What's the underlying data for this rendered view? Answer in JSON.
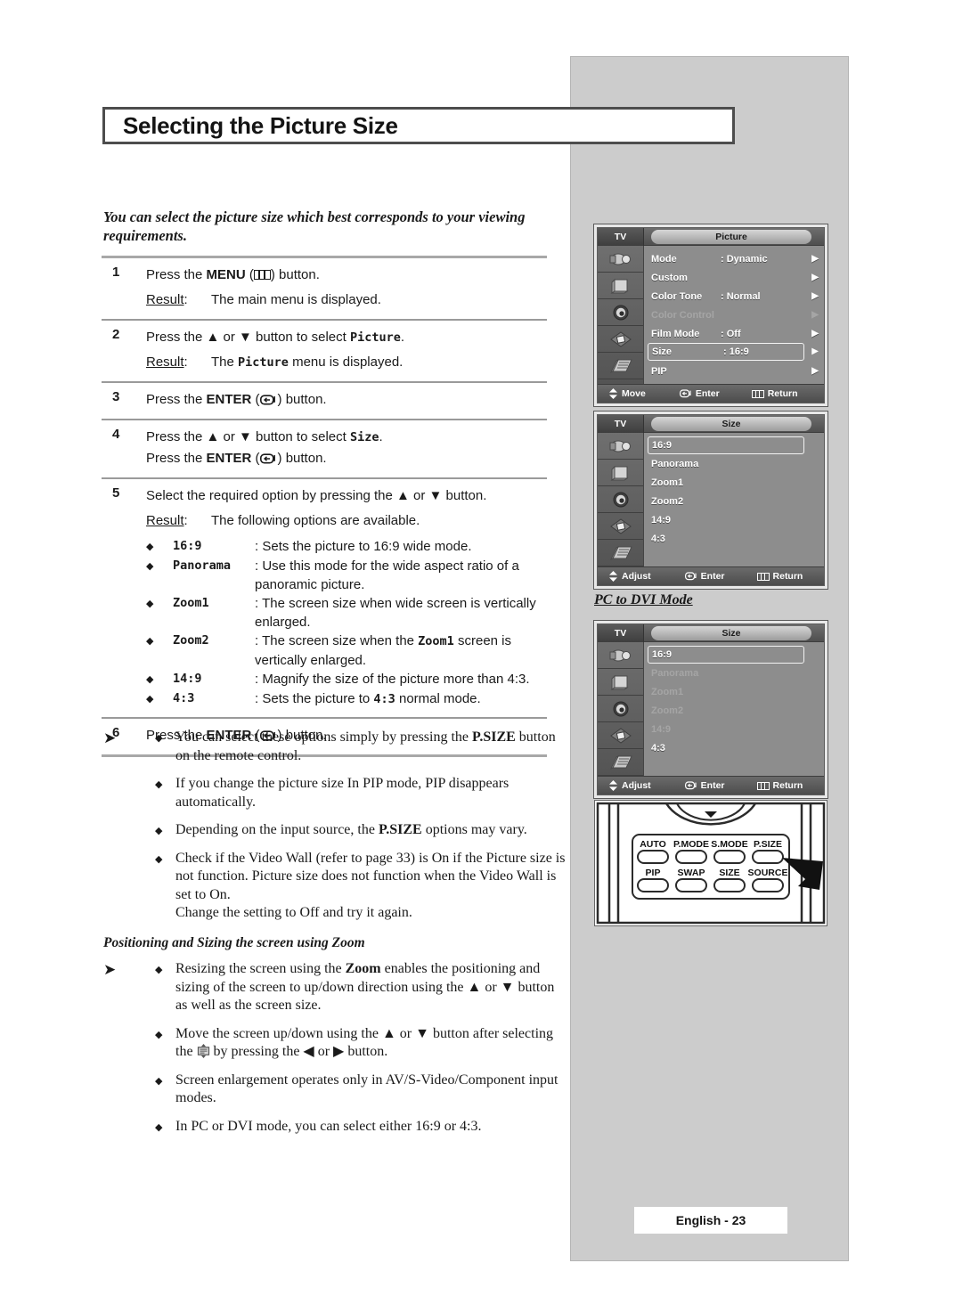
{
  "page": {
    "title": "Selecting the Picture Size",
    "intro": "You can select the picture size which best corresponds to your viewing requirements.",
    "footer": "English - 23"
  },
  "steps": [
    {
      "num": "1",
      "line1_pre": "Press the ",
      "line1_bold": "MENU",
      "line1_icon": "menu-icon",
      "line1_post": ") button.",
      "result_label": "Result",
      "result_text": "The main menu is displayed."
    },
    {
      "num": "2",
      "line1_pre": "Press the ▲ or ▼ button to select ",
      "line1_mono": "Picture",
      "line1_post": ".",
      "result_label": "Result",
      "result_pre": "The ",
      "result_mono": "Picture",
      "result_post": " menu is displayed."
    },
    {
      "num": "3",
      "line1_pre": "Press the ",
      "line1_bold": "ENTER",
      "line1_icon": "enter-icon",
      "line1_post": ") button."
    },
    {
      "num": "4",
      "line1_pre": "Press the ▲ or ▼ button to select ",
      "line1_mono": "Size",
      "line1_post": ".",
      "line2_pre": "Press the ",
      "line2_bold": "ENTER",
      "line2_icon": "enter-icon",
      "line2_post": ") button."
    },
    {
      "num": "5",
      "line1": "Select the required option by pressing the ▲ or ▼ button.",
      "result_label": "Result",
      "result_text": "The following options are available.",
      "options": [
        {
          "name": "16:9",
          "desc": "Sets the picture to 16:9 wide mode."
        },
        {
          "name": "Panorama",
          "desc": "Use this mode for the wide aspect ratio of a panoramic picture."
        },
        {
          "name": "Zoom1",
          "desc": "The screen size when wide screen is vertically enlarged."
        },
        {
          "name": "Zoom2",
          "desc_pre": "The screen size when the ",
          "desc_mono": "Zoom1",
          "desc_post": " screen is vertically enlarged."
        },
        {
          "name": "14:9",
          "desc": "Magnify the size of the picture more than 4:3."
        },
        {
          "name": "4:3",
          "desc_pre": "Sets the picture to ",
          "desc_mono": "4:3",
          "desc_post": " normal mode."
        }
      ]
    },
    {
      "num": "6",
      "line1_pre": "Press the ",
      "line1_bold": "ENTER",
      "line1_icon": "enter-icon",
      "line1_post": ") button."
    }
  ],
  "notes1": [
    {
      "pre": "You can select these options simply by pressing the ",
      "bold": "P.SIZE",
      "post": " button on the remote control."
    },
    {
      "pre": "If you change the picture size In PIP mode, PIP disappears automatically.",
      "bold": "",
      "post": ""
    },
    {
      "pre": "Depending on the input source, the ",
      "bold": "P.SIZE",
      "post": " options may vary."
    },
    {
      "pre": "Check if the Video Wall (refer to page 33) is On if the Picture size is not function. Picture size does not function when the Video Wall is set to On.",
      "bold": "",
      "post": "",
      "extra": "Change the setting to Off and try it again."
    }
  ],
  "zoom_section": {
    "heading": "Positioning and Sizing the screen using Zoom",
    "notes": [
      {
        "pre": "Resizing the screen using the ",
        "bold": "Zoom",
        "post": " enables the positioning and sizing of the screen to up/down direction using the ▲ or ▼ button as well as the screen size."
      },
      {
        "pre": "Move the screen up/down using the ▲ or ▼ button after selecting the ",
        "icon": "updown-box-icon",
        "post": " by pressing the ◀ or ▶ button."
      },
      {
        "pre": "Screen enlargement operates only in AV/S-Video/Component input modes.",
        "bold": "",
        "post": ""
      },
      {
        "pre": "In PC or DVI mode, you can select either 16:9 or 4:3.",
        "bold": "",
        "post": ""
      }
    ]
  },
  "osd_picture": {
    "source": "TV",
    "title": "Picture",
    "rows": [
      {
        "label": "Mode",
        "value": ": Dynamic",
        "state": "normal",
        "arrow": "▶"
      },
      {
        "label": "Custom",
        "value": "",
        "state": "normal",
        "arrow": "▶"
      },
      {
        "label": "Color Tone",
        "value": ": Normal",
        "state": "normal",
        "arrow": "▶"
      },
      {
        "label": "Color Control",
        "value": "",
        "state": "dim",
        "arrow": "▶"
      },
      {
        "label": "Film Mode",
        "value": ": Off",
        "state": "normal",
        "arrow": "▶"
      },
      {
        "label": "Size",
        "value": ": 16:9",
        "state": "selected",
        "arrow": "▶"
      },
      {
        "label": "PIP",
        "value": "",
        "state": "normal",
        "arrow": "▶"
      }
    ],
    "footer": [
      {
        "icon": "updown-icon",
        "label": "Move"
      },
      {
        "icon": "enter-icon",
        "label": "Enter"
      },
      {
        "icon": "menu-icon",
        "label": "Return"
      }
    ]
  },
  "osd_size": {
    "source": "TV",
    "title": "Size",
    "rows": [
      {
        "label": "16:9",
        "state": "selected"
      },
      {
        "label": "Panorama",
        "state": "normal"
      },
      {
        "label": "Zoom1",
        "state": "normal"
      },
      {
        "label": "Zoom2",
        "state": "normal"
      },
      {
        "label": "14:9",
        "state": "normal"
      },
      {
        "label": "4:3",
        "state": "normal"
      }
    ],
    "footer": [
      {
        "icon": "updown-icon",
        "label": "Adjust"
      },
      {
        "icon": "enter-icon",
        "label": "Enter"
      },
      {
        "icon": "menu-icon",
        "label": "Return"
      }
    ]
  },
  "osd_size_pcdvi": {
    "heading": "PC to DVI Mode",
    "source": "TV",
    "title": "Size",
    "rows": [
      {
        "label": "16:9",
        "state": "selected"
      },
      {
        "label": "Panorama",
        "state": "dim"
      },
      {
        "label": "Zoom1",
        "state": "dim"
      },
      {
        "label": "Zoom2",
        "state": "dim"
      },
      {
        "label": "14:9",
        "state": "dim"
      },
      {
        "label": "4:3",
        "state": "normal"
      }
    ],
    "footer": [
      {
        "icon": "updown-icon",
        "label": "Adjust"
      },
      {
        "icon": "enter-icon",
        "label": "Enter"
      },
      {
        "icon": "menu-icon",
        "label": "Return"
      }
    ]
  },
  "remote": {
    "buttons_row1": [
      "AUTO",
      "P.MODE",
      "S.MODE",
      "P.SIZE"
    ],
    "buttons_row2": [
      "PIP",
      "SWAP",
      "SIZE",
      "SOURCE"
    ],
    "pointer_target": "P.SIZE"
  },
  "colors": {
    "panel_gray": "#cccccc",
    "osd_body": "#8d8d8d",
    "osd_header_dark": "#5a5a5a",
    "rule": "#9a9a9a",
    "text": "#1a1a1a"
  }
}
